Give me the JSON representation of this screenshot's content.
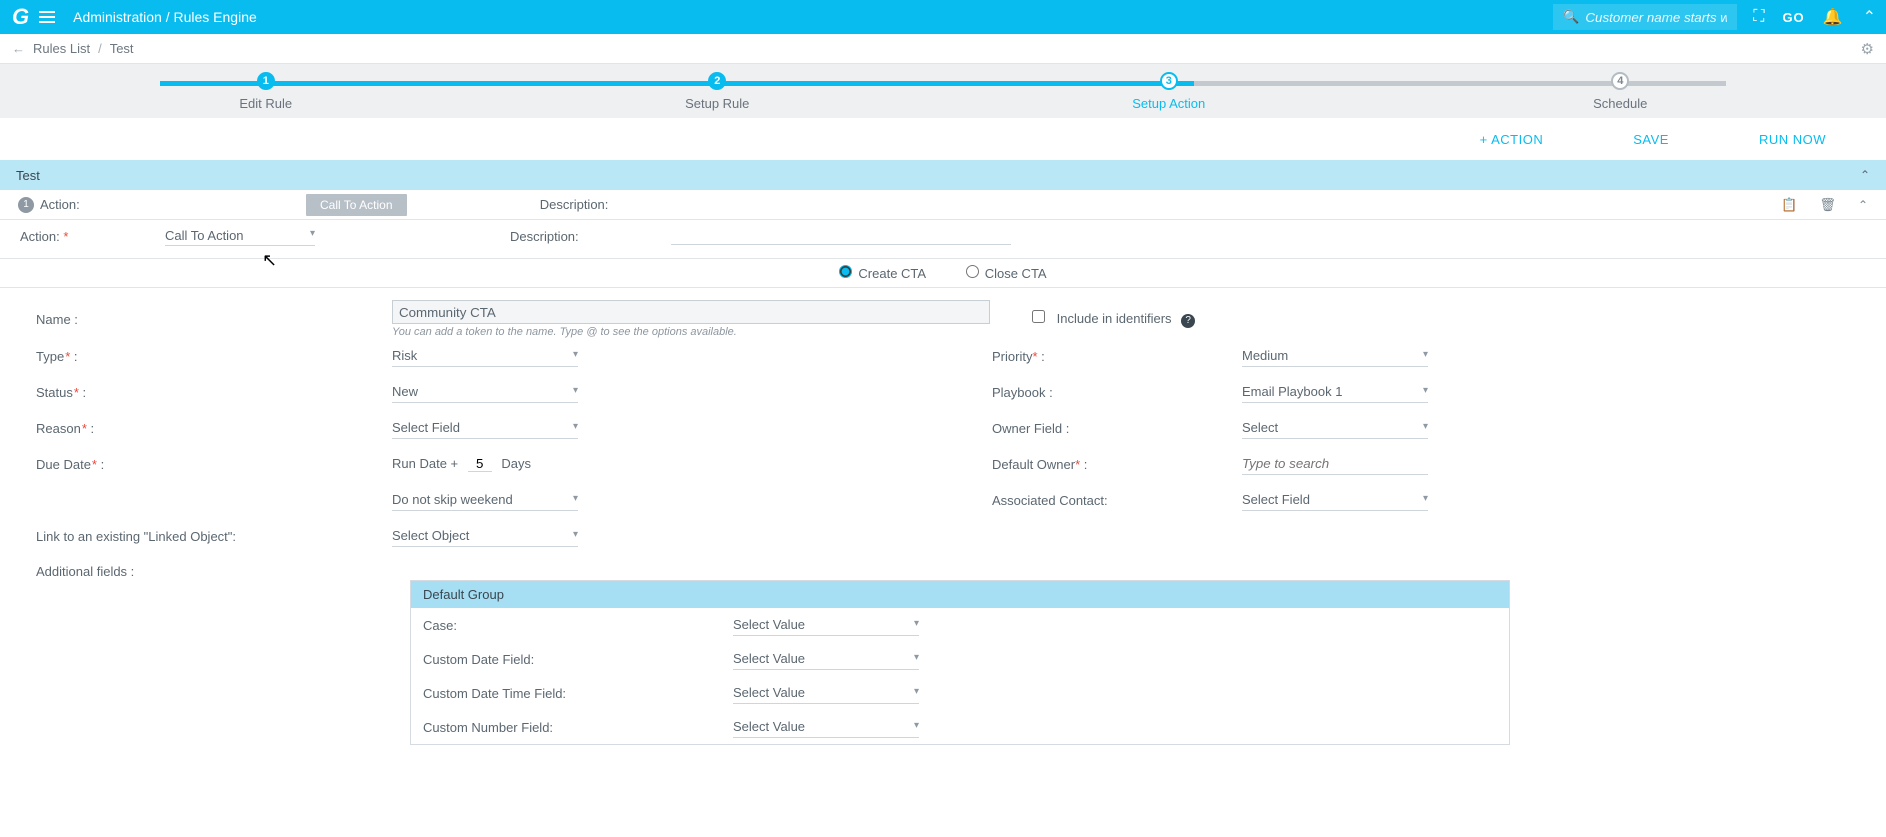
{
  "topbar": {
    "logo": "G",
    "crumb_a": "Administration",
    "crumb_sep": "/",
    "crumb_b": "Rules Engine",
    "search_placeholder": "Customer name starts with",
    "go": "GO"
  },
  "substrip": {
    "arrow": "←",
    "a": "Rules List",
    "sep": "/",
    "b": "Test"
  },
  "wizard": {
    "steps": [
      {
        "num": "1",
        "label": "Edit Rule"
      },
      {
        "num": "2",
        "label": "Setup Rule"
      },
      {
        "num": "3",
        "label": "Setup Action"
      },
      {
        "num": "4",
        "label": "Schedule"
      }
    ],
    "progress_pct": 66
  },
  "buttons": {
    "add_action": "+ ACTION",
    "save": "SAVE",
    "run_now": "RUN NOW"
  },
  "section_title": "Test",
  "acthdr": {
    "num": "1",
    "action_label": "Action:",
    "desc_label": "Description:",
    "tooltip": "Call To Action"
  },
  "actrow": {
    "label": "Action: ",
    "value": "Call To Action",
    "desc_label": "Description:"
  },
  "radio": {
    "create": "Create CTA",
    "close": "Close CTA"
  },
  "form": {
    "name_label": "Name :",
    "name_value": "Community CTA",
    "name_hint": "You can add a token to the name. Type @ to see the options available.",
    "include_label": "Include in identifiers",
    "type_label": "Type",
    "type_value": "Risk",
    "priority_label": "Priority",
    "priority_value": "Medium",
    "status_label": "Status",
    "status_value": "New",
    "playbook_label": "Playbook :",
    "playbook_value": "Email Playbook 1",
    "reason_label": "Reason",
    "reason_value": "Select Field",
    "owner_label": "Owner Field :",
    "owner_value": "Select",
    "due_label": "Due Date",
    "due_prefix": "Run Date + ",
    "due_days": "5",
    "due_suffix": "Days",
    "default_owner_label": "Default Owner",
    "default_owner_placeholder": "Type to search",
    "skip_value": "Do not skip weekend",
    "assoc_label": "Associated Contact:",
    "assoc_value": "Select Field",
    "link_label": "Link to an existing \"Linked Object\":",
    "link_value": "Select Object",
    "addl_label": "Additional fields :"
  },
  "default_group": {
    "title": "Default Group",
    "rows": [
      {
        "label": "Case:",
        "value": "Select Value"
      },
      {
        "label": "Custom Date Field:",
        "value": "Select Value"
      },
      {
        "label": "Custom Date Time Field:",
        "value": "Select Value"
      },
      {
        "label": "Custom Number Field:",
        "value": "Select Value"
      }
    ]
  }
}
